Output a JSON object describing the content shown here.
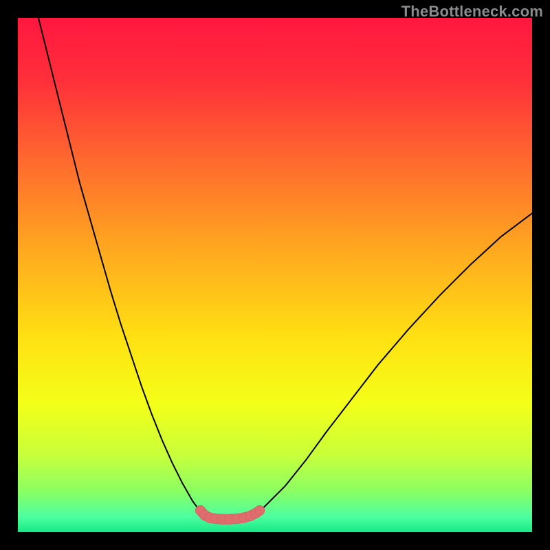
{
  "watermark": "TheBottleneck.com",
  "colors": {
    "gradient_stops": [
      {
        "offset": 0.0,
        "color": "#ff173f"
      },
      {
        "offset": 0.12,
        "color": "#ff2f3a"
      },
      {
        "offset": 0.28,
        "color": "#ff6a2e"
      },
      {
        "offset": 0.45,
        "color": "#ffa81f"
      },
      {
        "offset": 0.62,
        "color": "#ffe012"
      },
      {
        "offset": 0.75,
        "color": "#f4ff18"
      },
      {
        "offset": 0.85,
        "color": "#c8ff3a"
      },
      {
        "offset": 0.92,
        "color": "#8bff62"
      },
      {
        "offset": 0.97,
        "color": "#4dffa0"
      },
      {
        "offset": 1.0,
        "color": "#17e887"
      }
    ],
    "curve": "#000000",
    "marker_fill": "#e06d6d",
    "marker_stroke": "#c95b5b"
  },
  "chart_data": {
    "type": "line",
    "title": "",
    "xlabel": "",
    "ylabel": "",
    "xlim": [
      0,
      100
    ],
    "ylim": [
      0,
      100
    ],
    "series": [
      {
        "name": "left-branch",
        "x": [
          4,
          6,
          8,
          10,
          12,
          14,
          16,
          18,
          20,
          22,
          24,
          26,
          28,
          30,
          32,
          34,
          35.5
        ],
        "y": [
          100,
          92,
          84,
          76,
          68,
          61,
          54,
          47,
          40.5,
          34.5,
          28.5,
          23,
          18,
          13.5,
          9.5,
          6,
          4
        ]
      },
      {
        "name": "right-branch",
        "x": [
          47,
          49,
          52,
          56,
          60,
          65,
          70,
          76,
          82,
          88,
          94,
          100
        ],
        "y": [
          4,
          6,
          9,
          14,
          19.5,
          26,
          32.5,
          39.5,
          46,
          52,
          57.5,
          62
        ]
      }
    ],
    "flat_segment": {
      "x_start": 35.5,
      "x_end": 47,
      "y": 3
    },
    "markers": {
      "x": [
        35.5,
        36.3,
        37.3,
        38.5,
        39.8,
        41.2,
        42.6,
        44,
        45.3,
        46.3,
        47
      ],
      "y": [
        4.2,
        3.3,
        2.8,
        2.6,
        2.5,
        2.5,
        2.6,
        2.8,
        3.2,
        3.7,
        4.2
      ],
      "radius_data_units": 1.0
    }
  }
}
